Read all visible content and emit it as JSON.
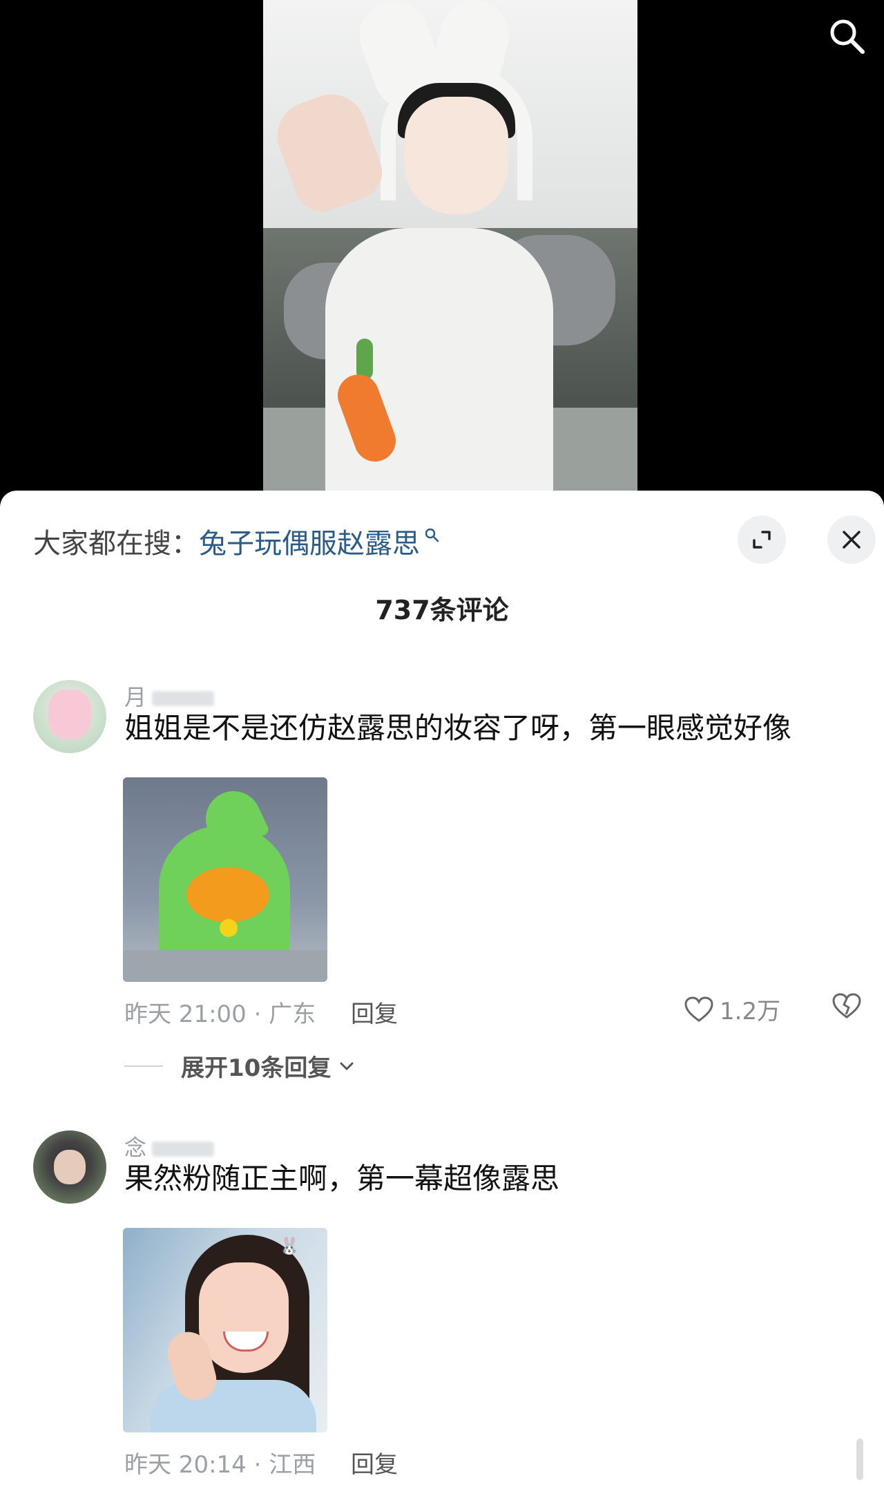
{
  "video": {
    "search_icon": "search-icon"
  },
  "panel": {
    "hint_label": "大家都在搜：",
    "hint_query": "兔子玩偶服赵露思",
    "hint_icon": "search-icon",
    "comment_count": "737条评论",
    "expand_icon": "expand-icon",
    "close_icon": "close-icon"
  },
  "comments": [
    {
      "username": "月",
      "text": "姐姐是不是还仿赵露思的妆容了呀，第一眼感觉好像",
      "time_location": "昨天 21:00 · 广东",
      "reply_label": "回复",
      "likes": "1.2万",
      "expand_label": "展开10条回复"
    },
    {
      "username": "念",
      "text": "果然粉随正主啊，第一幕超像露思",
      "time_location": "昨天 20:14 · 江西",
      "reply_label": "回复"
    }
  ],
  "colors": {
    "query_link": "#2b5b87",
    "sheet_bg": "#ffffff"
  }
}
